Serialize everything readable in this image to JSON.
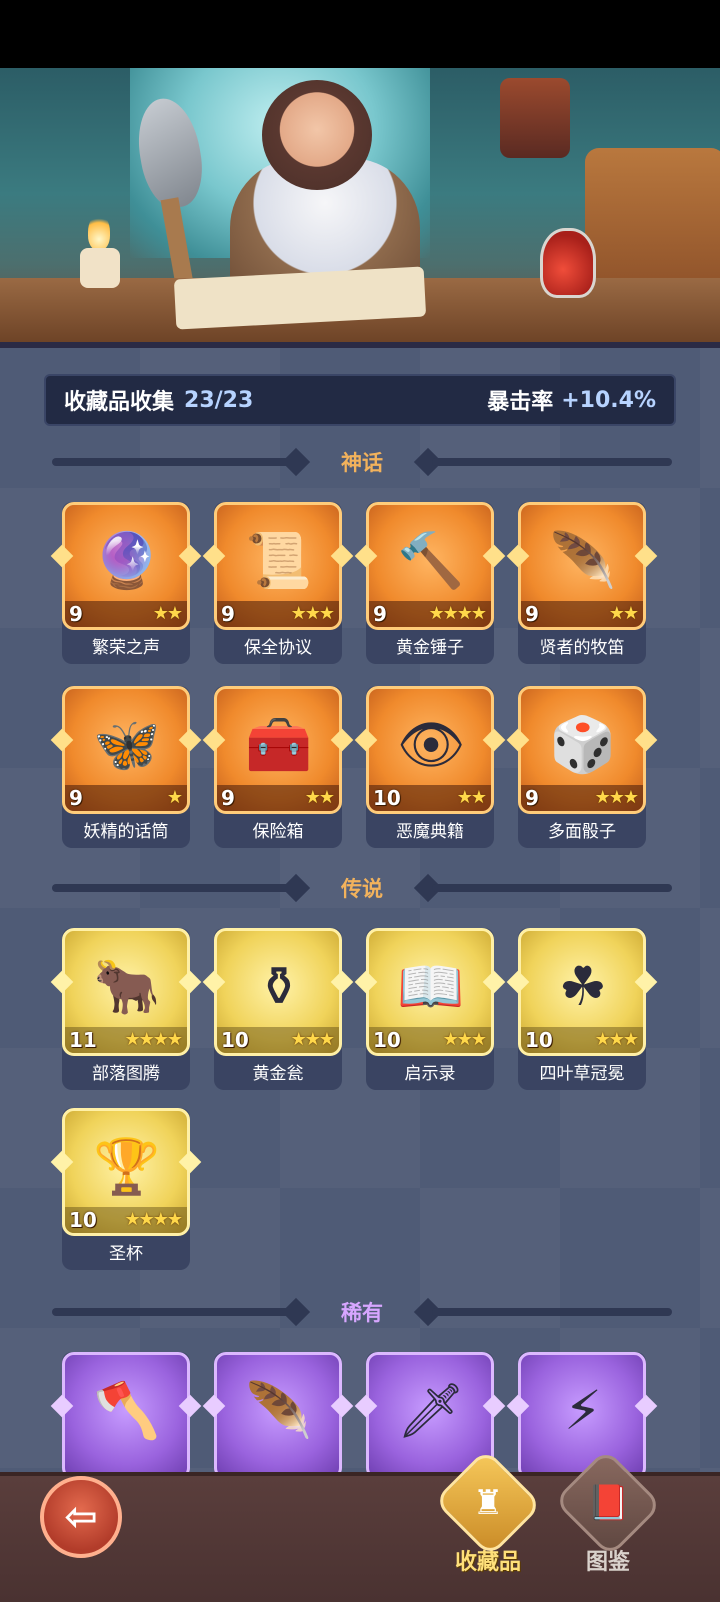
{
  "summary": {
    "label": "收藏品收集",
    "count": "23/23",
    "crit_label": "暴击率",
    "crit_value": "+10.4%"
  },
  "sections": {
    "mythic": "神话",
    "legend": "传说",
    "rare": "稀有"
  },
  "mythic_items": [
    {
      "name": "繁荣之声",
      "level": "9",
      "stars": "★★",
      "icon": "bell-orb-icon"
    },
    {
      "name": "保全协议",
      "level": "9",
      "stars": "★★★",
      "icon": "scroll-contract-icon"
    },
    {
      "name": "黄金锤子",
      "level": "9",
      "stars": "★★★★",
      "icon": "golden-hammer-icon"
    },
    {
      "name": "贤者的牧笛",
      "level": "9",
      "stars": "★★",
      "icon": "flute-icon"
    },
    {
      "name": "妖精的话筒",
      "level": "9",
      "stars": "★",
      "icon": "fairy-microphone-icon"
    },
    {
      "name": "保险箱",
      "level": "9",
      "stars": "★★",
      "icon": "safe-box-icon"
    },
    {
      "name": "恶魔典籍",
      "level": "10",
      "stars": "★★",
      "icon": "demon-book-icon"
    },
    {
      "name": "多面骰子",
      "level": "9",
      "stars": "★★★",
      "icon": "dice-icon"
    }
  ],
  "legend_items": [
    {
      "name": "部落图腾",
      "level": "11",
      "stars": "★★★★",
      "icon": "tribal-totem-icon"
    },
    {
      "name": "黄金瓮",
      "level": "10",
      "stars": "★★★",
      "icon": "golden-urn-icon"
    },
    {
      "name": "启示录",
      "level": "10",
      "stars": "★★★",
      "icon": "revelation-book-icon"
    },
    {
      "name": "四叶草冠冕",
      "level": "10",
      "stars": "★★★",
      "icon": "clover-crown-icon"
    },
    {
      "name": "圣杯",
      "level": "10",
      "stars": "★★★★",
      "icon": "holy-grail-icon"
    }
  ],
  "rare_items": [
    {
      "icon": "axe-icon"
    },
    {
      "icon": "feather-icon"
    },
    {
      "icon": "skull-sword-icon"
    },
    {
      "icon": "lightning-card-icon"
    }
  ],
  "nav": {
    "collection_label": "收藏品",
    "codex_label": "图鉴"
  }
}
